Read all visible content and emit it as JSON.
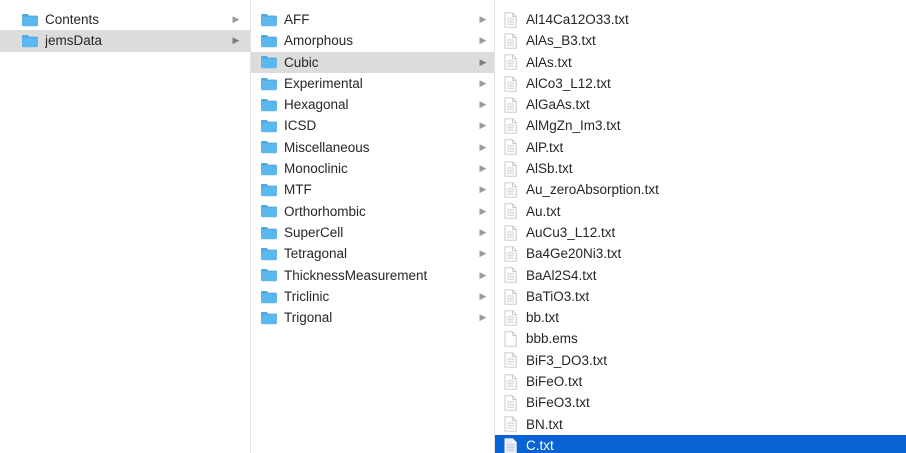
{
  "columns": {
    "col1": {
      "items": [
        {
          "label": "Contents",
          "selected": false
        },
        {
          "label": "jemsData",
          "selected": true
        }
      ]
    },
    "col2": {
      "items": [
        {
          "label": "AFF",
          "selected": false
        },
        {
          "label": "Amorphous",
          "selected": false
        },
        {
          "label": "Cubic",
          "selected": true
        },
        {
          "label": "Experimental",
          "selected": false
        },
        {
          "label": "Hexagonal",
          "selected": false
        },
        {
          "label": "ICSD",
          "selected": false
        },
        {
          "label": "Miscellaneous",
          "selected": false
        },
        {
          "label": "Monoclinic",
          "selected": false
        },
        {
          "label": "MTF",
          "selected": false
        },
        {
          "label": "Orthorhombic",
          "selected": false
        },
        {
          "label": "SuperCell",
          "selected": false
        },
        {
          "label": "Tetragonal",
          "selected": false
        },
        {
          "label": "ThicknessMeasurement",
          "selected": false
        },
        {
          "label": "Triclinic",
          "selected": false
        },
        {
          "label": "Trigonal",
          "selected": false
        }
      ]
    },
    "col3": {
      "items": [
        {
          "label": "Al14Ca12O33.txt",
          "icon": "text-file-icon"
        },
        {
          "label": "AlAs_B3.txt",
          "icon": "text-file-icon"
        },
        {
          "label": "AlAs.txt",
          "icon": "text-file-icon"
        },
        {
          "label": "AlCo3_L12.txt",
          "icon": "text-file-icon"
        },
        {
          "label": "AlGaAs.txt",
          "icon": "text-file-icon"
        },
        {
          "label": "AlMgZn_Im3.txt",
          "icon": "text-file-icon"
        },
        {
          "label": "AlP.txt",
          "icon": "text-file-icon"
        },
        {
          "label": "AlSb.txt",
          "icon": "text-file-icon"
        },
        {
          "label": "Au_zeroAbsorption.txt",
          "icon": "text-file-icon"
        },
        {
          "label": "Au.txt",
          "icon": "text-file-icon"
        },
        {
          "label": "AuCu3_L12.txt",
          "icon": "text-file-icon"
        },
        {
          "label": "Ba4Ge20Ni3.txt",
          "icon": "text-file-icon"
        },
        {
          "label": "BaAl2S4.txt",
          "icon": "text-file-icon"
        },
        {
          "label": "BaTiO3.txt",
          "icon": "text-file-icon"
        },
        {
          "label": "bb.txt",
          "icon": "text-file-icon"
        },
        {
          "label": "bbb.ems",
          "icon": "blank-file-icon"
        },
        {
          "label": "BiF3_DO3.txt",
          "icon": "text-file-icon"
        },
        {
          "label": "BiFeO.txt",
          "icon": "text-file-icon"
        },
        {
          "label": "BiFeO3.txt",
          "icon": "text-file-icon"
        },
        {
          "label": "BN.txt",
          "icon": "text-file-icon"
        },
        {
          "label": "C.txt",
          "icon": "text-file-icon",
          "selected": true
        }
      ]
    }
  },
  "icons": {
    "folder": "folder-icon",
    "chevron": "chevron-right-icon",
    "text_file": "text-file-icon",
    "blank_file": "blank-file-icon"
  },
  "colors": {
    "folder_fill": "#5ab8ee",
    "folder_tab": "#4ea7dd",
    "selection_active": "#0a63d4",
    "selection_inactive": "#dcdcdc",
    "file_icon_stroke": "#c4c4c4",
    "file_icon_lines": "#cfcfcf"
  }
}
